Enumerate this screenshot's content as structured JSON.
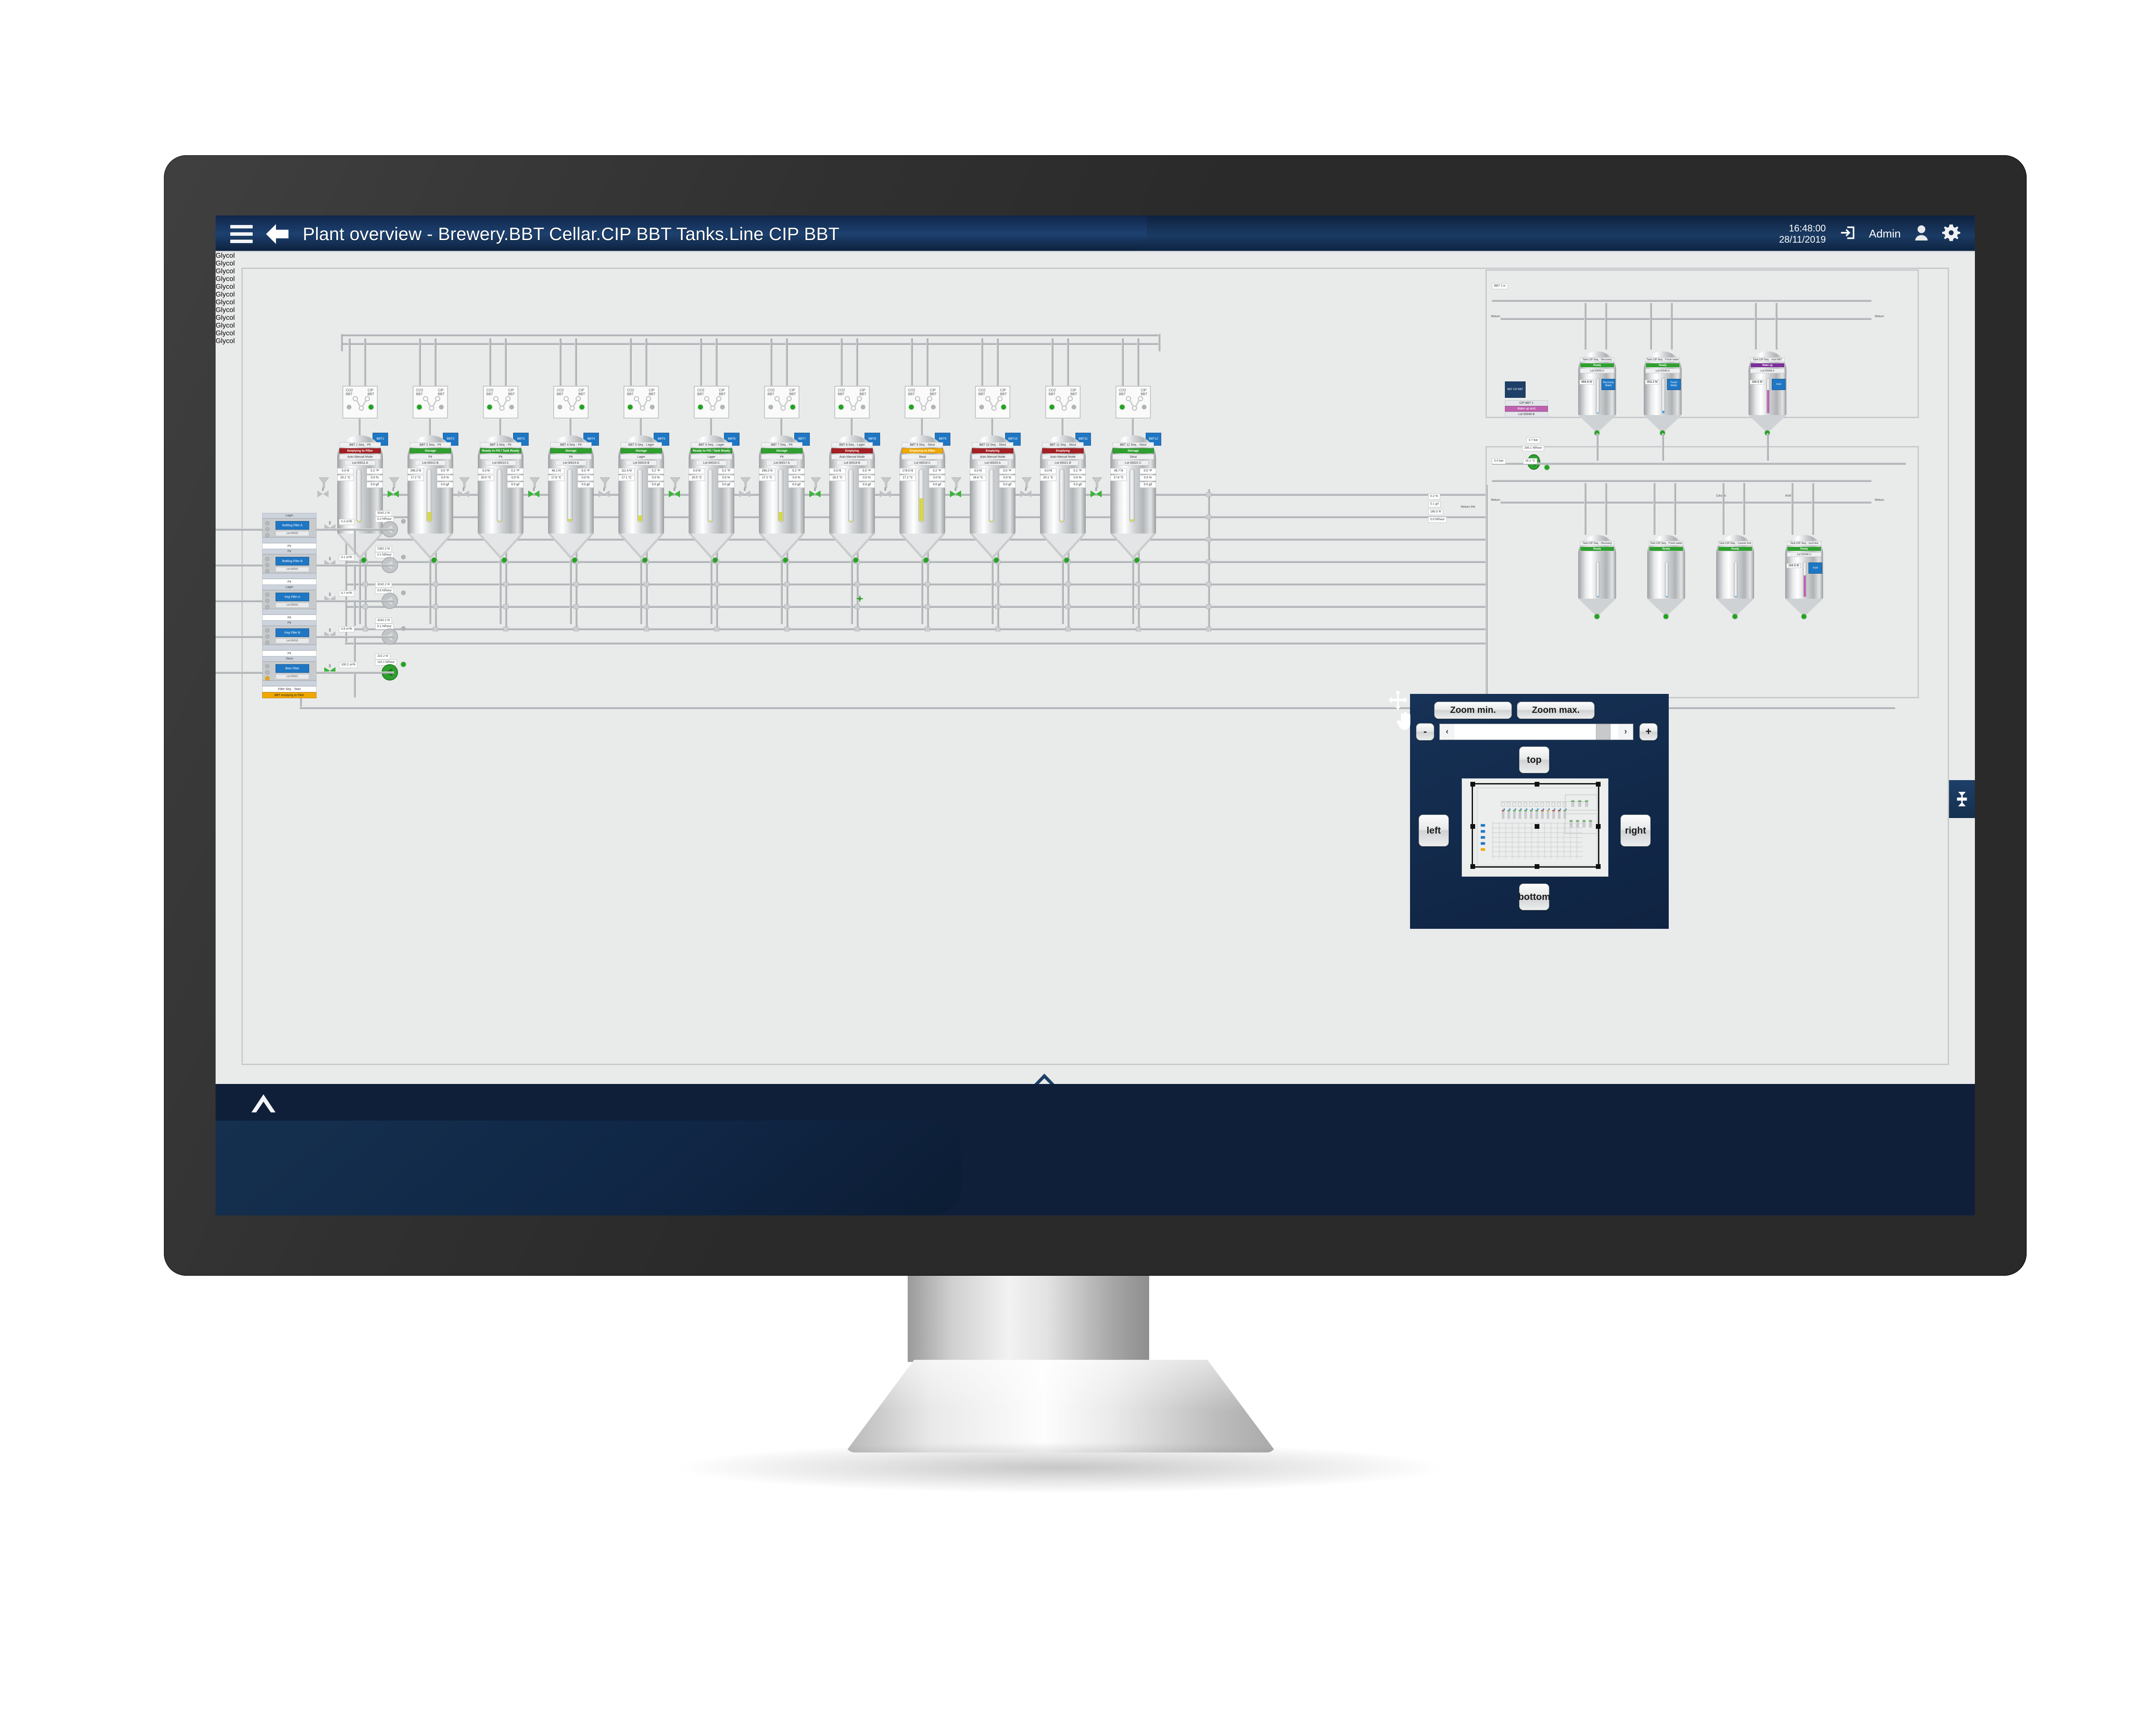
{
  "header": {
    "title": "Plant overview - Brewery.BBT Cellar.CIP BBT Tanks.Line CIP BBT",
    "menu_icon": "hamburger-icon",
    "back_icon": "back-arrow-icon",
    "time": "16:48:00",
    "date": "28/11/2019",
    "logout_icon": "logout-icon",
    "user_label": "Admin",
    "user_icon": "user-icon",
    "settings_icon": "gear-icon"
  },
  "nav_panel": {
    "pan_icon": "move-cursor-icon",
    "hand_icon": "hand-drag-icon",
    "zoom_min_label": "Zoom min.",
    "zoom_max_label": "Zoom max.",
    "minus_label": "-",
    "plus_label": "+",
    "scroll_left_label": "‹",
    "scroll_right_label": "›",
    "top_label": "top",
    "bottom_label": "bottom",
    "left_label": "left",
    "right_label": "right",
    "minimap_name": "plant-overview-minimap"
  },
  "edge_tab": {
    "icon": "valve-equipment-icon"
  },
  "bottom": {
    "expand_icon": "chevron-up-icon",
    "center_expand_icon": "chevron-up-icon"
  },
  "mimic": {
    "manifold_left_label": "CO2",
    "manifold_left_sub": "BBT",
    "manifold_right_label": "CIP",
    "manifold_right_sub": "BBT",
    "glycol_label": "Glycol",
    "tanks": [
      {
        "tag": "BBT1",
        "seq": "BBT 1 Seq. : Pit",
        "status": "Emptying to Filter",
        "status_color": "#a52025",
        "mode": "Auto Manual Mode",
        "lot": "Lot 00011 A",
        "vol": "0.0 hl",
        "temp": "20.1 °C",
        "press": "0.2 °P",
        "pct": "0.0 %",
        "co2": "0.0 g/l",
        "level_pct": 0,
        "level_color": "#d8d842"
      },
      {
        "tag": "BBT2",
        "seq": "BBT 2 Seq. : Pit",
        "status": "Storage",
        "status_color": "#2fa02f",
        "mode": "Pit",
        "lot": "Lot 00012 B",
        "vol": "296.2 hl",
        "temp": "17.2 °C",
        "press": "0.0 °P",
        "pct": "0.0 %",
        "co2": "0.0 g/l",
        "level_pct": 18,
        "level_color": "#d8d842"
      },
      {
        "tag": "BBT3",
        "seq": "BBT 3 Seq. : Pit",
        "status": "Ready to Fill / Tank Ready",
        "status_color": "#2fa02f",
        "mode": "Pit",
        "lot": "Lot 00013 C",
        "vol": "0.0 hl",
        "temp": "20.0 °C",
        "press": "0.2 °P",
        "pct": "0.0 %",
        "co2": "0.0 g/l",
        "level_pct": 0,
        "level_color": "#d8d842"
      },
      {
        "tag": "BBT4",
        "seq": "BBT 4 Seq. : Pit",
        "status": "Storage",
        "status_color": "#2fa02f",
        "mode": "Pit",
        "lot": "Lot 00014 A",
        "vol": "46.1 hl",
        "temp": "17.8 °C",
        "press": "0.0 °P",
        "pct": "0.0 %",
        "co2": "0.0 g/l",
        "level_pct": 5,
        "level_color": "#d8d842"
      },
      {
        "tag": "BBT5",
        "seq": "BBT 5 Seq. : Lager",
        "status": "Storage",
        "status_color": "#2fa02f",
        "mode": "Lager",
        "lot": "Lot 00015 B",
        "vol": "111.4 hl",
        "temp": "17.1 °C",
        "press": "0.2 °P",
        "pct": "0.0 %",
        "co2": "0.0 g/l",
        "level_pct": 12,
        "level_color": "#d8d842"
      },
      {
        "tag": "BBT6",
        "seq": "BBT 6 Seq. : Lager",
        "status": "Ready to Fill / Tank Ready",
        "status_color": "#2fa02f",
        "mode": "Lager",
        "lot": "Lot 00016 C",
        "vol": "0.0 hl",
        "temp": "20.5 °C",
        "press": "0.2 °P",
        "pct": "0.0 %",
        "co2": "0.0 g/l",
        "level_pct": 0,
        "level_color": "#d8d842"
      },
      {
        "tag": "BBT7",
        "seq": "BBT 7 Seq. : Pit",
        "status": "Storage",
        "status_color": "#2fa02f",
        "mode": "Pit",
        "lot": "Lot 00017 A",
        "vol": "296.2 hl",
        "temp": "17.2 °C",
        "press": "0.2 °P",
        "pct": "0.0 %",
        "co2": "0.0 g/l",
        "level_pct": 18,
        "level_color": "#d8d842"
      },
      {
        "tag": "BBT8",
        "seq": "BBT 8 Seq. : Lager",
        "status": "Emptying",
        "status_color": "#a52025",
        "mode": "Auto Manual Mode",
        "lot": "Lot 00018 B",
        "vol": "0.0 hl",
        "temp": "18.2 °C",
        "press": "0.0 °P",
        "pct": "0.0 %",
        "co2": "0.0 g/l",
        "level_pct": 0,
        "level_color": "#d8d842"
      },
      {
        "tag": "BBT9",
        "seq": "BBT 9 Seq. : Stout",
        "status": "Emptying to Filter",
        "status_color": "#f0a800",
        "mode": "Stout",
        "lot": "Lot 00019 C",
        "vol": "178.0 hl",
        "temp": "17.2 °C",
        "press": "0.2 °P",
        "pct": "0.0 %",
        "co2": "0.0 g/l",
        "level_pct": 45,
        "level_color": "#d8d842"
      },
      {
        "tag": "BBT10",
        "seq": "BBT 10 Seq. : Stout",
        "status": "Emptying",
        "status_color": "#a52025",
        "mode": "Auto Manual Mode",
        "lot": "Lot 00020 A",
        "vol": "0.0 hl",
        "temp": "18.4 °C",
        "press": "0.0 °P",
        "pct": "0.0 %",
        "co2": "0.0 g/l",
        "level_pct": 0,
        "level_color": "#d8d842"
      },
      {
        "tag": "BBT11",
        "seq": "BBT 11 Seq. : Stout",
        "status": "Emptying",
        "status_color": "#a52025",
        "mode": "Auto Manual Mode",
        "lot": "Lot 00021 B",
        "vol": "0.0 hl",
        "temp": "20.1 °C",
        "press": "0.2 °P",
        "pct": "0.0 %",
        "co2": "0.0 g/l",
        "level_pct": 0,
        "level_color": "#d8d842"
      },
      {
        "tag": "BBT12",
        "seq": "BBT 12 Seq. : Stout",
        "status": "Storage",
        "status_color": "#2fa02f",
        "mode": "Stout",
        "lot": "Lot 00022 C",
        "vol": "46.7 hl",
        "temp": "17.8 °C",
        "press": "0.0 °P",
        "pct": "0.0 %",
        "co2": "0.0 g/l",
        "level_pct": 4,
        "level_color": "#d8d842"
      }
    ],
    "feeds": [
      {
        "head": "Lager",
        "button": "Bottling Filler A",
        "sub": "Lot 00010",
        "name": "Pit",
        "status": "",
        "status_color": "",
        "led_on": false,
        "flow": "0.2 m³/h",
        "vol": "3242.2 hl",
        "rate": "0.2 hl/hour",
        "valve_on": false
      },
      {
        "head": "Pit",
        "button": "Bottling Filler B",
        "sub": "Lot 00010",
        "name": "Pit",
        "status": "",
        "status_color": "",
        "led_on": false,
        "flow": "0.1 m³/h",
        "vol": "2362.2 hl",
        "rate": "0.1 hl/hour",
        "valve_on": false
      },
      {
        "head": "Lager",
        "button": "Keg Filler A",
        "sub": "Lot 00010",
        "name": "Pit",
        "status": "",
        "status_color": "",
        "led_on": false,
        "flow": "0.7 m³/h",
        "vol": "3242.2 hl",
        "rate": "0.6 hl/hour",
        "valve_on": false
      },
      {
        "head": "Pit",
        "button": "Keg Filler B",
        "sub": "Lot 00010",
        "name": "Pit",
        "status": "",
        "status_color": "",
        "led_on": false,
        "flow": "0.6 m³/h",
        "vol": "3242.2 hl",
        "rate": "0.1 hl/hour",
        "valve_on": false
      },
      {
        "head": "Stout",
        "button": "Beer Filter",
        "sub": "Lot 00021",
        "name": "Filter Seq. : Start",
        "status": "BBT emptying to Filter",
        "status_color": "#f0a800",
        "led_on": true,
        "flow": "100.2 m³/h",
        "vol": "222.2 hl",
        "rate": "110.1 hl/hour",
        "valve_on": true
      }
    ],
    "cip_modules": [
      {
        "name": "recovery-cip-module",
        "top_label": "BBT 2 in",
        "return_left": "Return",
        "return_right": "Return",
        "legend_title": "BBT CIP BBT",
        "legend_items": [
          "CIP BBT 1",
          "Make up acid",
          "Lot 00046 B"
        ],
        "pressure": "3.7 bar",
        "flow": "200.1 hl/hour",
        "tanks": [
          {
            "seq": "Tank CIP Seq. : Recovery water BBT",
            "status": "Ready",
            "status_color": "#2fa02f",
            "lot": "Lot 00045 A",
            "vol": "484.6 hl",
            "tag": "Recovery Water",
            "level_pct": 0,
            "level_color": "#3ea7e0"
          },
          {
            "seq": "Tank CIP Seq. : Fresh water BBT",
            "status": "Ready",
            "status_color": "#2fa02f",
            "lot": "Lot 00045 A",
            "vol": "353.2 hl",
            "tag": "Fresh Water",
            "level_pct": 8,
            "level_color": "#3ea7e0"
          },
          {
            "seq": "Tank CIP Seq. : Acid BBT",
            "status": "Make up",
            "status_color": "#7b2f99",
            "lot": "Lot 00046 A",
            "vol": "184.0 hl",
            "tag": "Acid",
            "level_pct": 68,
            "level_color": "#c060b0"
          }
        ]
      },
      {
        "name": "caustic-cip-module",
        "top_label_1": "0.0 bar",
        "top_label_2": "16.1 °C",
        "return_left": "Return",
        "return_right": "Return",
        "caustic_label": "Caustic",
        "acid_label": "Acid",
        "tanks": [
          {
            "seq": "Tank CIP Seq. : Recovery water",
            "status": "Ready",
            "status_color": "#2fa02f",
            "lot": "",
            "vol": "",
            "tag": "",
            "level_pct": 0,
            "level_color": "#3ea7e0"
          },
          {
            "seq": "Tank CIP Seq. : Fresh water line",
            "status": "Ready",
            "status_color": "#2fa02f",
            "lot": "",
            "vol": "",
            "tag": "",
            "level_pct": 0,
            "level_color": "#3ea7e0"
          },
          {
            "seq": "Tank CIP Seq. : Caustic line",
            "status": "Ready",
            "status_color": "#2fa02f",
            "lot": "",
            "vol": "",
            "tag": "",
            "level_pct": 0,
            "level_color": "#3ea7e0"
          },
          {
            "seq": "Tank CIP Seq. : Acid line",
            "status": "Ready",
            "status_color": "#2fa02f",
            "lot": "Lot 00046 U",
            "vol": "184.0 hl",
            "tag": "Acid",
            "level_pct": 62,
            "level_color": "#c060b0"
          }
        ]
      }
    ],
    "misc_labels": {
      "return_drain": "Return 5%",
      "pct": "0.2 %",
      "gl": "0.1 g/l",
      "vol2": "180.0 hl",
      "flow2": "0.0 hl/hour",
      "bar": "97.0 pa"
    }
  },
  "colors": {
    "accent_blue": "#1f77c4",
    "header_dark": "#12294a",
    "status_ok": "#2fa02f",
    "status_alarm": "#a52025",
    "status_warn": "#f0a800",
    "status_makeup": "#7b2f99",
    "panel_bg": "#12294a"
  }
}
